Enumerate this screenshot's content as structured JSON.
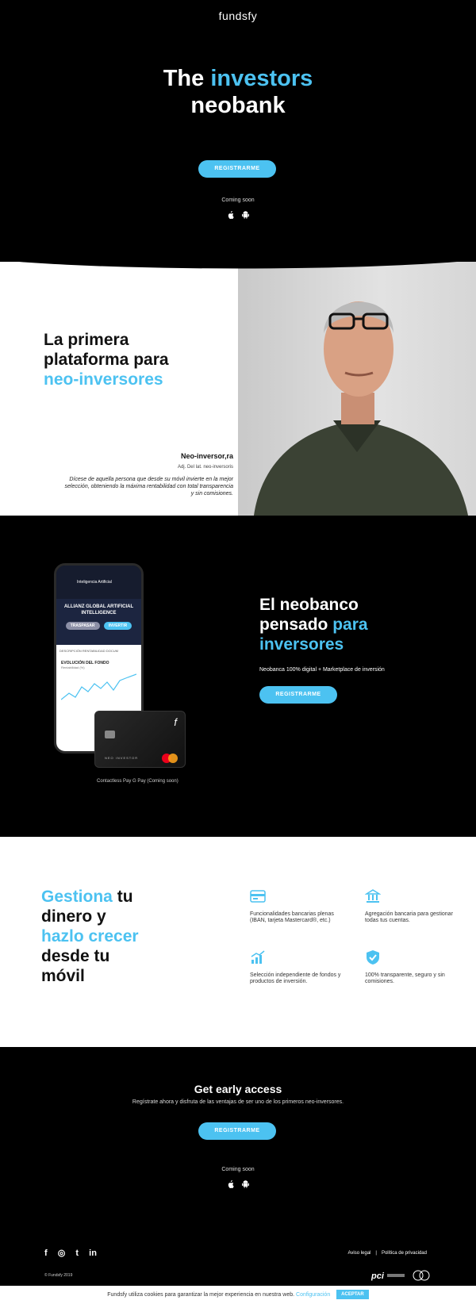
{
  "brand": {
    "logo": "fundsfy"
  },
  "colors": {
    "accent": "#4cc2f1",
    "dark": "#000000"
  },
  "hero": {
    "title_part1": "The",
    "title_accent": "investors",
    "title_part2": "neobank",
    "cta": "REGISTRARME",
    "coming_soon": "Coming soon",
    "icons": [
      "apple-icon",
      "android-icon"
    ]
  },
  "platform": {
    "title_line1": "La primera",
    "title_line2": "plataforma para",
    "title_accent": "neo-inversores",
    "definition_title": "Neo-inversor,ra",
    "definition_sub": "Adj. Del lat. neo-inversoris",
    "definition_text": "Dícese de aquella persona que desde su móvil invierte en la mejor selección, obteniendo la máxima rentabilidad con total transparencia y sin comisiones."
  },
  "neobank": {
    "title_line1": "El neobanco",
    "title_line2a": "pensado",
    "title_line2_accent": "para",
    "title_line3_accent": "inversores",
    "subtitle": "Neobanca 100% digital + Marketplace de inversión",
    "cta": "REGISTRARME",
    "phone_header": "Inteligencia Artificial",
    "phone_fund": "ALLIANZ GLOBAL ARTIFICIAL INTELLIGENCE",
    "phone_btn1": "TRASPASAR",
    "phone_btn2": "INVERTIR",
    "phone_tabs": "DESCRIPCIÓN   RENTABILIDAD   DOCUM",
    "phone_chart_title": "EVOLUCIÓN DEL FONDO",
    "phone_chart_sub": "Rentabilidad (%)",
    "card_name": "NEO INVESTOR",
    "pay_line": "Contactless   Pay   G Pay (Coming soon)"
  },
  "manage": {
    "title_accent1": "Gestiona",
    "title_1": "tu",
    "title_2": "dinero y",
    "title_accent2": "hazlo crecer",
    "title_3": "desde tu",
    "title_4": "móvil",
    "features": [
      {
        "icon": "card-icon",
        "text": "Funcionalidades bancarias plenas (IBAN, tarjeta Mastercard®, etc.)"
      },
      {
        "icon": "bank-icon",
        "text": "Agregación bancaria para gestionar todas tus cuentas."
      },
      {
        "icon": "growth-chart-icon",
        "text": "Selección independiente de fondos y productos de inversión."
      },
      {
        "icon": "shield-check-icon",
        "text": "100% transparente, seguro y sin comisiones."
      }
    ]
  },
  "early": {
    "title": "Get early access",
    "subtitle": "Regístrate ahora y disfruta de las ventajas de ser uno de los primeros neo-inversores.",
    "cta": "REGISTRARME",
    "coming_soon": "Coming soon"
  },
  "footer": {
    "social": [
      "f",
      "◎",
      "t",
      "in"
    ],
    "legal": "Aviso legal",
    "privacy": "Política de privacidad",
    "copyright": "© Fundsfy 2019"
  },
  "cookie": {
    "text": "Fundsfy utiliza cookies para garantizar la mejor experiencia en nuestra web.",
    "config": "Configuración",
    "accept": "ACEPTAR"
  }
}
